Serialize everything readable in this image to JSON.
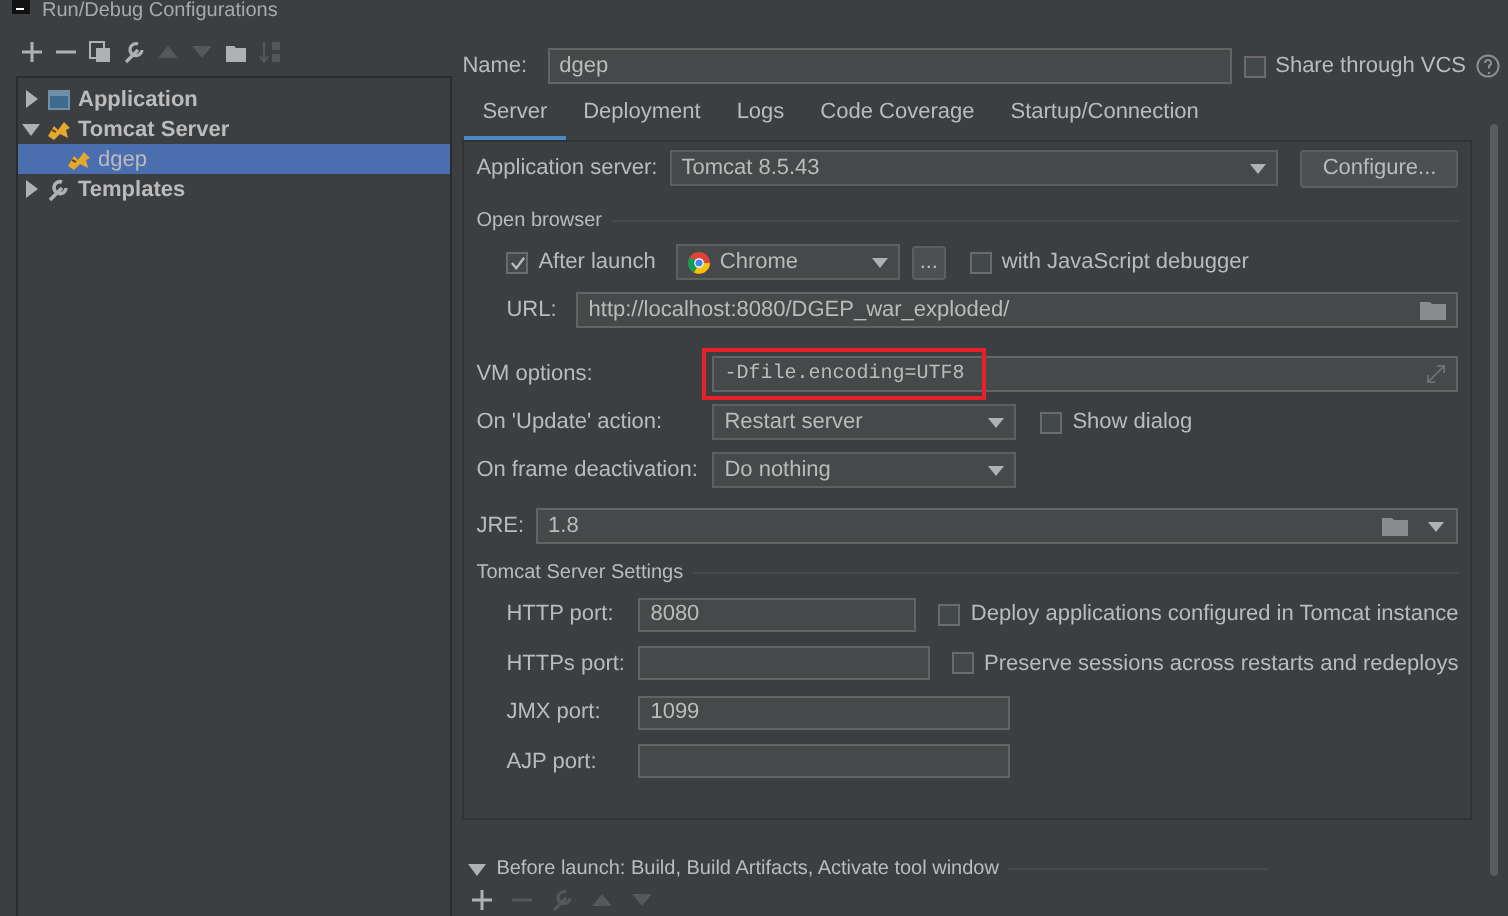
{
  "window": {
    "title": "Run/Debug Configurations"
  },
  "sidebar": {
    "toolbar": [
      {
        "kind": "add",
        "disabled": false
      },
      {
        "kind": "remove",
        "disabled": false
      },
      {
        "kind": "copy",
        "disabled": false
      },
      {
        "kind": "edit",
        "disabled": false
      },
      {
        "kind": "up",
        "disabled": true
      },
      {
        "kind": "down",
        "disabled": true
      },
      {
        "kind": "folder",
        "disabled": false
      },
      {
        "kind": "sort",
        "disabled": true
      }
    ],
    "tree": [
      {
        "label": "Application",
        "kind": "application",
        "expanded": false,
        "selected": false
      },
      {
        "label": "Tomcat Server",
        "kind": "tomcat",
        "expanded": true,
        "selected": false,
        "children": [
          {
            "label": "dgep",
            "kind": "tomcat",
            "selected": true
          }
        ]
      },
      {
        "label": "Templates",
        "kind": "templates",
        "expanded": false,
        "selected": false
      }
    ]
  },
  "name_field": {
    "label": "Name:",
    "value": "dgep"
  },
  "share": {
    "label": "Share through VCS",
    "checked": false
  },
  "tabs": [
    {
      "label": "Server",
      "selected": true
    },
    {
      "label": "Deployment",
      "selected": false
    },
    {
      "label": "Logs",
      "selected": false
    },
    {
      "label": "Code Coverage",
      "selected": false
    },
    {
      "label": "Startup/Connection",
      "selected": false
    }
  ],
  "server": {
    "app_server": {
      "label": "Application server:",
      "value": "Tomcat 8.5.43"
    },
    "configure_button": "Configure...",
    "open_browser": {
      "title": "Open browser",
      "after_launch": {
        "label": "After launch",
        "checked": true
      },
      "browser": "Chrome",
      "more_button": "...",
      "js_debugger": {
        "label": "with JavaScript debugger",
        "checked": false
      },
      "url": {
        "label": "URL:",
        "value": "http://localhost:8080/DGEP_war_exploded/"
      }
    },
    "vm_options": {
      "label": "VM options:",
      "value": "-Dfile.encoding=UTF8",
      "highlighted": true
    },
    "update_action": {
      "label": "On 'Update' action:",
      "value": "Restart server",
      "show_dialog": {
        "label": "Show dialog",
        "checked": false
      }
    },
    "frame_deactivation": {
      "label": "On frame deactivation:",
      "value": "Do nothing"
    },
    "jre": {
      "label": "JRE:",
      "value": "1.8"
    },
    "tomcat_settings": {
      "title": "Tomcat Server Settings",
      "ports": [
        {
          "label": "HTTP port:",
          "value": "8080"
        },
        {
          "label": "HTTPs port:"
        },
        {
          "label": "JMX port:",
          "value": "1099"
        },
        {
          "label": "AJP port:"
        }
      ],
      "options": [
        {
          "label": "Deploy applications configured in Tomcat instance",
          "checked": false
        },
        {
          "label": "Preserve sessions across restarts and redeploys",
          "checked": false
        }
      ]
    }
  },
  "before_launch": {
    "label": "Before launch: Build, Build Artifacts, Activate tool window",
    "expanded": true,
    "toolbar": [
      {
        "kind": "add",
        "disabled": false
      },
      {
        "kind": "remove",
        "disabled": true
      },
      {
        "kind": "edit",
        "disabled": true
      },
      {
        "kind": "up",
        "disabled": true
      },
      {
        "kind": "down",
        "disabled": true
      }
    ]
  }
}
